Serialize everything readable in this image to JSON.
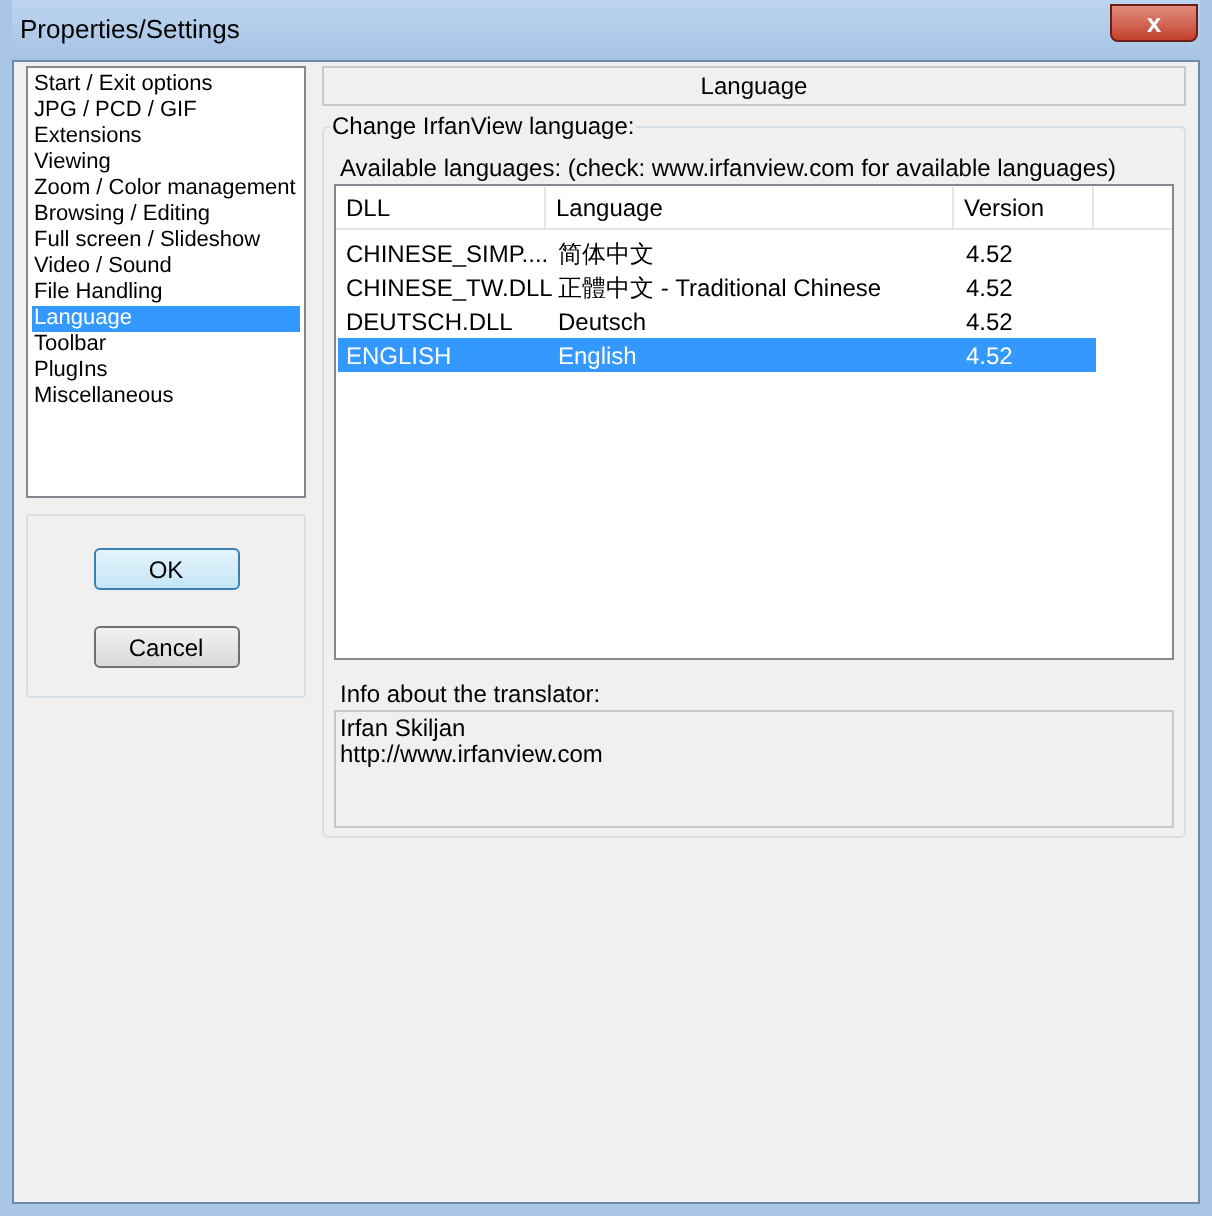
{
  "window": {
    "title": "Properties/Settings",
    "close_glyph": "x"
  },
  "sidebar": {
    "items": [
      {
        "label": "Start / Exit options",
        "selected": false
      },
      {
        "label": "JPG / PCD / GIF",
        "selected": false
      },
      {
        "label": "Extensions",
        "selected": false
      },
      {
        "label": "Viewing",
        "selected": false
      },
      {
        "label": "Zoom / Color management",
        "selected": false
      },
      {
        "label": "Browsing / Editing",
        "selected": false
      },
      {
        "label": "Full screen / Slideshow",
        "selected": false
      },
      {
        "label": "Video / Sound",
        "selected": false
      },
      {
        "label": "File Handling",
        "selected": false
      },
      {
        "label": "Language",
        "selected": true
      },
      {
        "label": "Toolbar",
        "selected": false
      },
      {
        "label": "PlugIns",
        "selected": false
      },
      {
        "label": "Miscellaneous",
        "selected": false
      }
    ]
  },
  "buttons": [
    {
      "label": "OK",
      "default": true
    },
    {
      "label": "Cancel",
      "default": false
    }
  ],
  "page_title": "Language",
  "group": {
    "title": "Change IrfanView language:",
    "list_label": "Available languages: (check: www.irfanview.com for available languages)",
    "table": {
      "columns": [
        "DLL",
        "Language",
        "Version"
      ],
      "rows": [
        {
          "cells": [
            "CHINESE_SIMP....",
            "简体中文",
            "4.52"
          ],
          "selected": false
        },
        {
          "cells": [
            "CHINESE_TW.DLL",
            "正體中文 - Traditional Chinese",
            "4.52"
          ],
          "selected": false
        },
        {
          "cells": [
            "DEUTSCH.DLL",
            "Deutsch",
            "4.52"
          ],
          "selected": false
        },
        {
          "cells": [
            "ENGLISH",
            "English",
            "4.52"
          ],
          "selected": true
        }
      ]
    },
    "info_label": "Info about the translator:",
    "info_lines": [
      "Irfan Skiljan",
      "http://www.irfanview.com"
    ]
  }
}
